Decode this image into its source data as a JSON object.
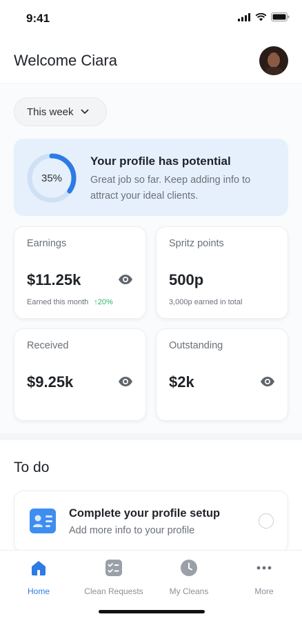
{
  "status_bar": {
    "time": "9:41"
  },
  "header": {
    "welcome_text": "Welcome Ciara"
  },
  "period_selector": {
    "value": "This week"
  },
  "profile_card": {
    "progress_label": "35%",
    "progress_fraction": 0.35,
    "title": "Your profile has potential",
    "description": "Great job so far. Keep adding info to attract your ideal clients."
  },
  "stats": {
    "earnings": {
      "label": "Earnings",
      "value": "$11.25k",
      "sub": "Earned this month",
      "trend": "↑20%"
    },
    "spritz_points": {
      "label": "Spritz points",
      "value": "500p",
      "sub": "3,000p earned in total"
    },
    "received": {
      "label": "Received",
      "value": "$9.25k"
    },
    "outstanding": {
      "label": "Outstanding",
      "value": "$2k"
    }
  },
  "todo": {
    "title": "To do",
    "items": [
      {
        "title": "Complete your profile setup",
        "description": "Add more info to your profile"
      }
    ]
  },
  "tabs": [
    {
      "label": "Home",
      "icon": "home-icon",
      "active": true
    },
    {
      "label": "Clean Requests",
      "icon": "checklist-icon",
      "active": false
    },
    {
      "label": "My Cleans",
      "icon": "clock-icon",
      "active": false
    },
    {
      "label": "More",
      "icon": "more-icon",
      "active": false
    }
  ],
  "colors": {
    "accent": "#2d7be5",
    "profile_card_bg": "#e6f0fc",
    "trend_positive": "#2fb36b"
  }
}
